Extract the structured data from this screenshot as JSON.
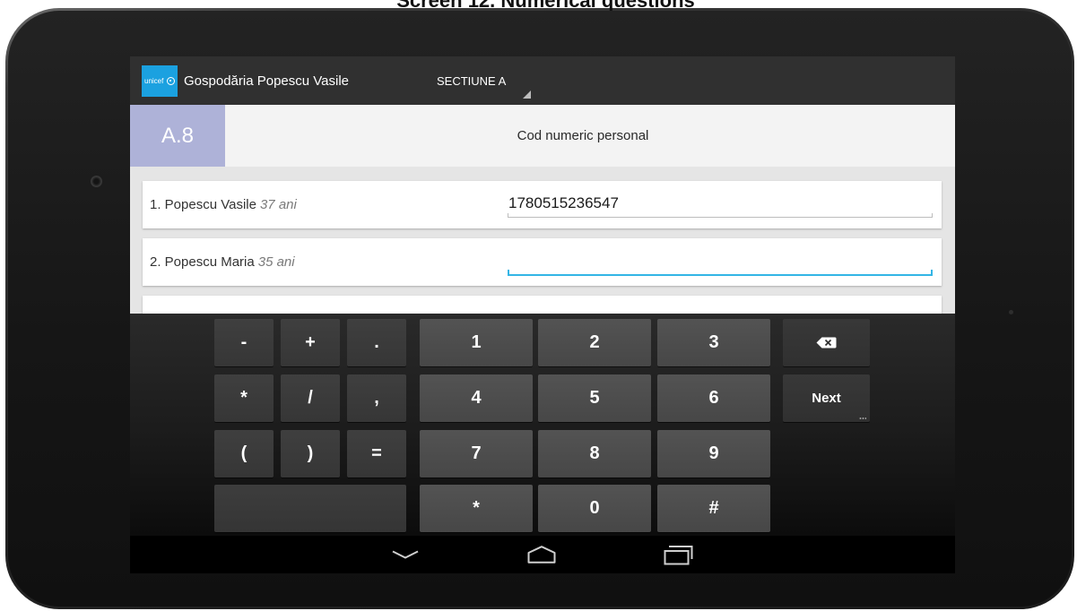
{
  "caption": "Screen 12. Numerical questions",
  "colors": {
    "accent": "#33b5e5",
    "question_code_bg": "#aeb2d8",
    "logo_bg": "#1ba1e0",
    "action_bar_bg": "#303030"
  },
  "app_bar": {
    "logo": {
      "text": "unicef",
      "icon": "unicef-globe-icon"
    },
    "title": "Gospodăria Popescu Vasile",
    "section_spinner": {
      "selected": "SECTIUNE A",
      "icon": "spinner-corner-arrow-icon"
    }
  },
  "question": {
    "code": "A.8",
    "title": "Cod numeric personal"
  },
  "answers": [
    {
      "label": "1. Popescu Vasile",
      "age": "37 ani",
      "value": "1780515236547",
      "focused": false
    },
    {
      "label": "2. Popescu Maria",
      "age": "35 ani",
      "value": "",
      "focused": true
    }
  ],
  "keyboard": {
    "symbol_keys": [
      [
        "-",
        "+",
        "."
      ],
      [
        "*",
        "/",
        ","
      ],
      [
        "(",
        ")",
        "="
      ]
    ],
    "number_keys": [
      [
        "1",
        "2",
        "3"
      ],
      [
        "4",
        "5",
        "6"
      ],
      [
        "7",
        "8",
        "9"
      ],
      [
        "*",
        "0",
        "#"
      ]
    ],
    "backspace_icon": "backspace-icon",
    "action_label": "Next"
  },
  "nav_bar": {
    "back_icon": "back-icon",
    "home_icon": "home-icon",
    "recents_icon": "recents-icon"
  }
}
